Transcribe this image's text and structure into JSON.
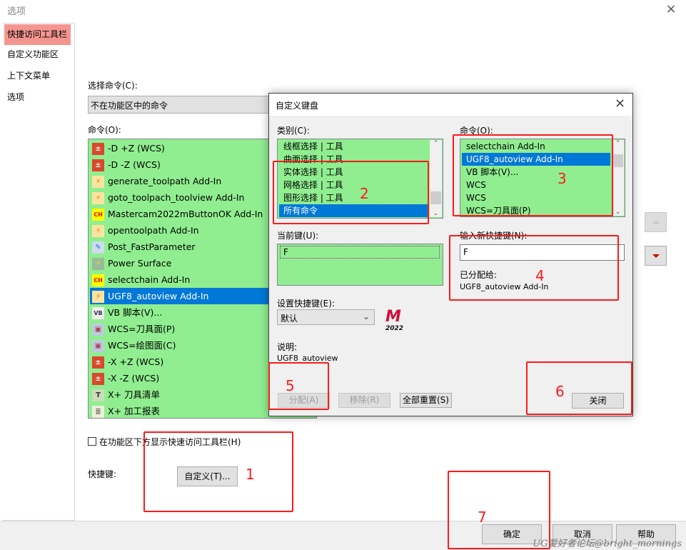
{
  "window": {
    "title": "选项",
    "close": "×"
  },
  "nav": {
    "items": [
      {
        "label": "快捷访问工具栏",
        "selected": true
      },
      {
        "label": "自定义功能区"
      },
      {
        "label": "上下文菜单"
      },
      {
        "label": "选项"
      }
    ]
  },
  "main": {
    "choose_label": "选择命令(C):",
    "choose_value": "不在功能区中的命令",
    "commands_label": "命令(O):",
    "commands": [
      {
        "icon": "wcs-icon",
        "label": "-D +Z (WCS)"
      },
      {
        "icon": "wcs-icon",
        "label": "-D -Z (WCS)"
      },
      {
        "icon": "addin-icon",
        "label": "generate_toolpath Add-In"
      },
      {
        "icon": "addin-icon",
        "label": "goto_toolpach_toolview Add-In"
      },
      {
        "icon": "ch-icon",
        "label": "Mastercam2022mButtonOK Add-In"
      },
      {
        "icon": "addin-icon",
        "label": "opentoolpath Add-In"
      },
      {
        "icon": "pencil-icon",
        "label": "Post_FastParameter"
      },
      {
        "icon": "power-surface-icon",
        "label": "Power Surface"
      },
      {
        "icon": "ch-icon",
        "label": "selectchain Add-In"
      },
      {
        "icon": "addin-icon",
        "label": "UGF8_autoview Add-In",
        "selected": true
      },
      {
        "icon": "vb-icon",
        "label": "VB 脚本(V)..."
      },
      {
        "icon": "wcs-plane-icon",
        "label": "WCS=刀具面(P)"
      },
      {
        "icon": "wcs-plane-icon",
        "label": "WCS=绘图面(C)"
      },
      {
        "icon": "wcs-icon",
        "label": "-X +Z (WCS)"
      },
      {
        "icon": "wcs-icon",
        "label": "-X -Z (WCS)"
      },
      {
        "icon": "tool-list-icon",
        "label": "X+ 刀具清单"
      },
      {
        "icon": "report-icon",
        "label": "X+ 加工报表"
      }
    ],
    "show_below_label": "在功能区下方显示快速访问工具栏(H)",
    "show_below_checked": false,
    "shortcut_label": "快捷键:",
    "customize_button": "自定义(T)...",
    "ok": "确定",
    "cancel": "取消",
    "help": "帮助"
  },
  "dialog": {
    "title": "自定义键盘",
    "category_label": "类别(C):",
    "categories": [
      {
        "label": "线框选择 | 工具"
      },
      {
        "label": "曲面选择 | 工具"
      },
      {
        "label": "实体选择 | 工具"
      },
      {
        "label": "网格选择 | 工具"
      },
      {
        "label": "图形选择 | 工具"
      },
      {
        "label": "所有命令",
        "selected": true
      }
    ],
    "command_label": "命令(O):",
    "commands": [
      {
        "label": "selectchain Add-In"
      },
      {
        "label": "UGF8_autoview Add-In",
        "selected": true
      },
      {
        "label": "VB 脚本(V)..."
      },
      {
        "label": "WCS"
      },
      {
        "label": "WCS"
      },
      {
        "label": "WCS=刀具面(P)"
      }
    ],
    "current_key_label": "当前键(U):",
    "current_key": "F",
    "new_key_label": "输入新快捷键(N):",
    "new_key_value": "F",
    "assigned_label": "已分配给:",
    "assigned_value": "UGF8_autoview Add-In",
    "set_label": "设置快捷键(E):",
    "set_value": "默认",
    "logo_text": "2022",
    "desc_label": "说明:",
    "desc_value": "UGF8_autoview",
    "assign": "分配(A)",
    "remove": "移除(R)",
    "reset_all": "全部重置(S)",
    "close": "关闭"
  },
  "annotations": [
    "1",
    "2",
    "3",
    "4",
    "5",
    "6",
    "7"
  ],
  "watermark": "UG爱好者论坛@bright_mornings",
  "colors": {
    "list_bg": "#90ee90",
    "selection": "#0078d7",
    "nav_selected": "#f4968f",
    "annotation": "#ff1a1a"
  }
}
